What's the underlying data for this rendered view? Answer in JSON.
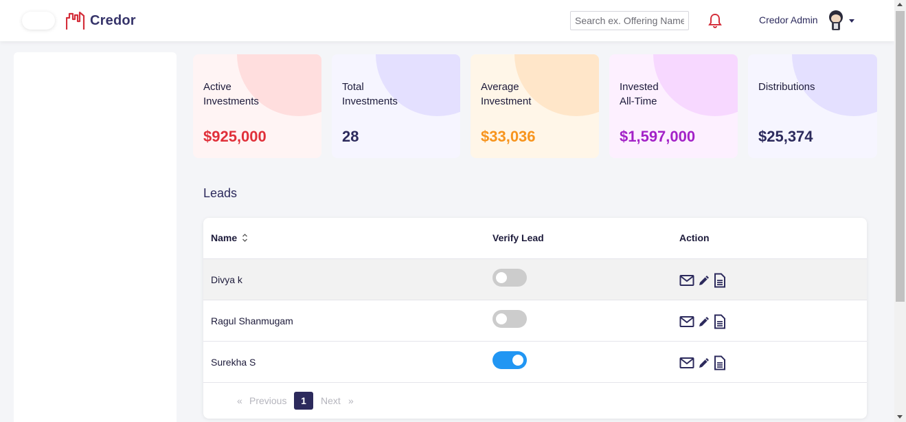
{
  "header": {
    "brand": "Credor",
    "search_placeholder": "Search ex. Offering Name",
    "user_name": "Credor Admin"
  },
  "stats": [
    {
      "label": "Active\nInvestments",
      "value": "$925,000",
      "value_color": "#e0303a",
      "bg": "#fff4f4",
      "accent": "#ffdede"
    },
    {
      "label": "Total\nInvestments",
      "value": "28",
      "value_color": "#2c2a5c",
      "bg": "#f6f5ff",
      "accent": "#e4e0ff"
    },
    {
      "label": "Average\nInvestment",
      "value": "$33,036",
      "value_color": "#f7941d",
      "bg": "#fff6e8",
      "accent": "#ffe6c9"
    },
    {
      "label": "Invested\nAll-Time",
      "value": "$1,597,000",
      "value_color": "#a322c7",
      "bg": "#fdf0ff",
      "accent": "#f7d8ff"
    },
    {
      "label": "Distributions",
      "value": "$25,374",
      "value_color": "#2c2a5c",
      "bg": "#f6f5ff",
      "accent": "#e4e0ff"
    }
  ],
  "leads": {
    "title": "Leads",
    "columns": [
      "Name",
      "Verify Lead",
      "Action"
    ],
    "rows": [
      {
        "name": "Divya k",
        "verified": false
      },
      {
        "name": "Ragul Shanmugam",
        "verified": false
      },
      {
        "name": "Surekha S",
        "verified": true
      }
    ],
    "pagination": {
      "prev_arrow": "«",
      "prev": "Previous",
      "page": "1",
      "next": "Next",
      "next_arrow": "»"
    }
  },
  "icons": {
    "menu": "menu-toggle",
    "bell": "bell-icon",
    "avatar": "avatar",
    "sort": "sort-icon",
    "mail": "mail-icon",
    "edit": "pencil-icon",
    "doc": "document-icon"
  }
}
